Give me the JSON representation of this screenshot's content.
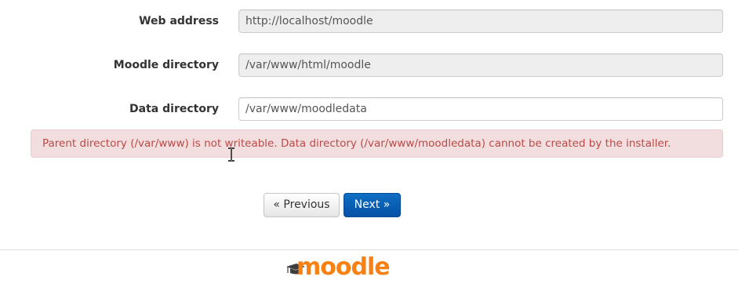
{
  "form": {
    "web_address": {
      "label": "Web address",
      "value": "http://localhost/moodle"
    },
    "moodle_directory": {
      "label": "Moodle directory",
      "value": "/var/www/html/moodle"
    },
    "data_directory": {
      "label": "Data directory",
      "value": "/var/www/moodledata"
    }
  },
  "error": {
    "message": "Parent directory (/var/www) is not writeable. Data directory (/var/www/moodledata) cannot be created by the installer.",
    "color": "#b94a48",
    "background": "#f2dede"
  },
  "buttons": {
    "previous_label": "« Previous",
    "next_label": "Next »",
    "next_color": "#0552a6"
  },
  "footer": {
    "logo_text": "moodle",
    "logo_icon": "graduation-cap-icon",
    "brand_color": "#f98012"
  },
  "cursor": {
    "icon": "text-cursor-icon"
  }
}
